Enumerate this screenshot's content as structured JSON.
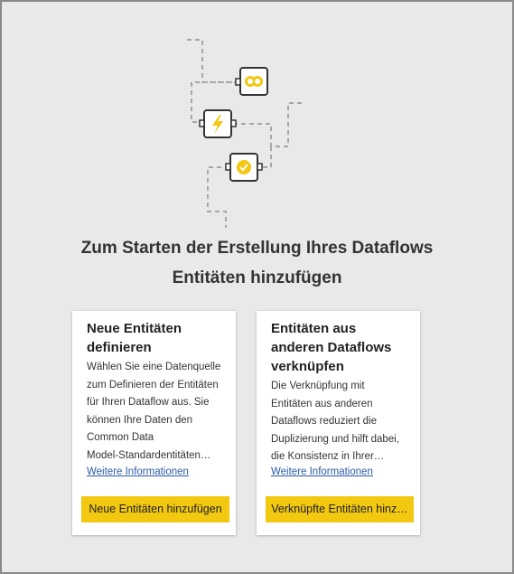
{
  "headline": {
    "line1": "Zum Starten der Erstellung Ihres Dataflows",
    "line2": "Entitäten hinzufügen"
  },
  "illustration_icons": [
    "link-icon",
    "lightning-icon",
    "checkmark-badge-icon"
  ],
  "colors": {
    "accent": "#f2c811",
    "background": "#e9e9e9",
    "link": "#2b5aa8"
  },
  "cards": [
    {
      "title": "Neue Entitäten\ndefinieren",
      "description": "Wählen Sie eine Datenquelle\nzum Definieren der Entitäten\nfür Ihren Dataflow aus. Sie\nkönnen Ihre Daten den\nCommon Data\nModel-Standardentitäten…",
      "link": "Weitere Informationen",
      "button": "Neue Entitäten hinzufügen"
    },
    {
      "title": "Entitäten aus\nanderen Dataflows\nverknüpfen",
      "description": "Die Verknüpfung mit\nEntitäten aus anderen\nDataflows reduziert die\nDuplizierung und hilft dabei,\ndie Konsistenz in Ihrer…",
      "link": "Weitere Informationen",
      "button": "Verknüpfte Entitäten hinz…"
    }
  ]
}
